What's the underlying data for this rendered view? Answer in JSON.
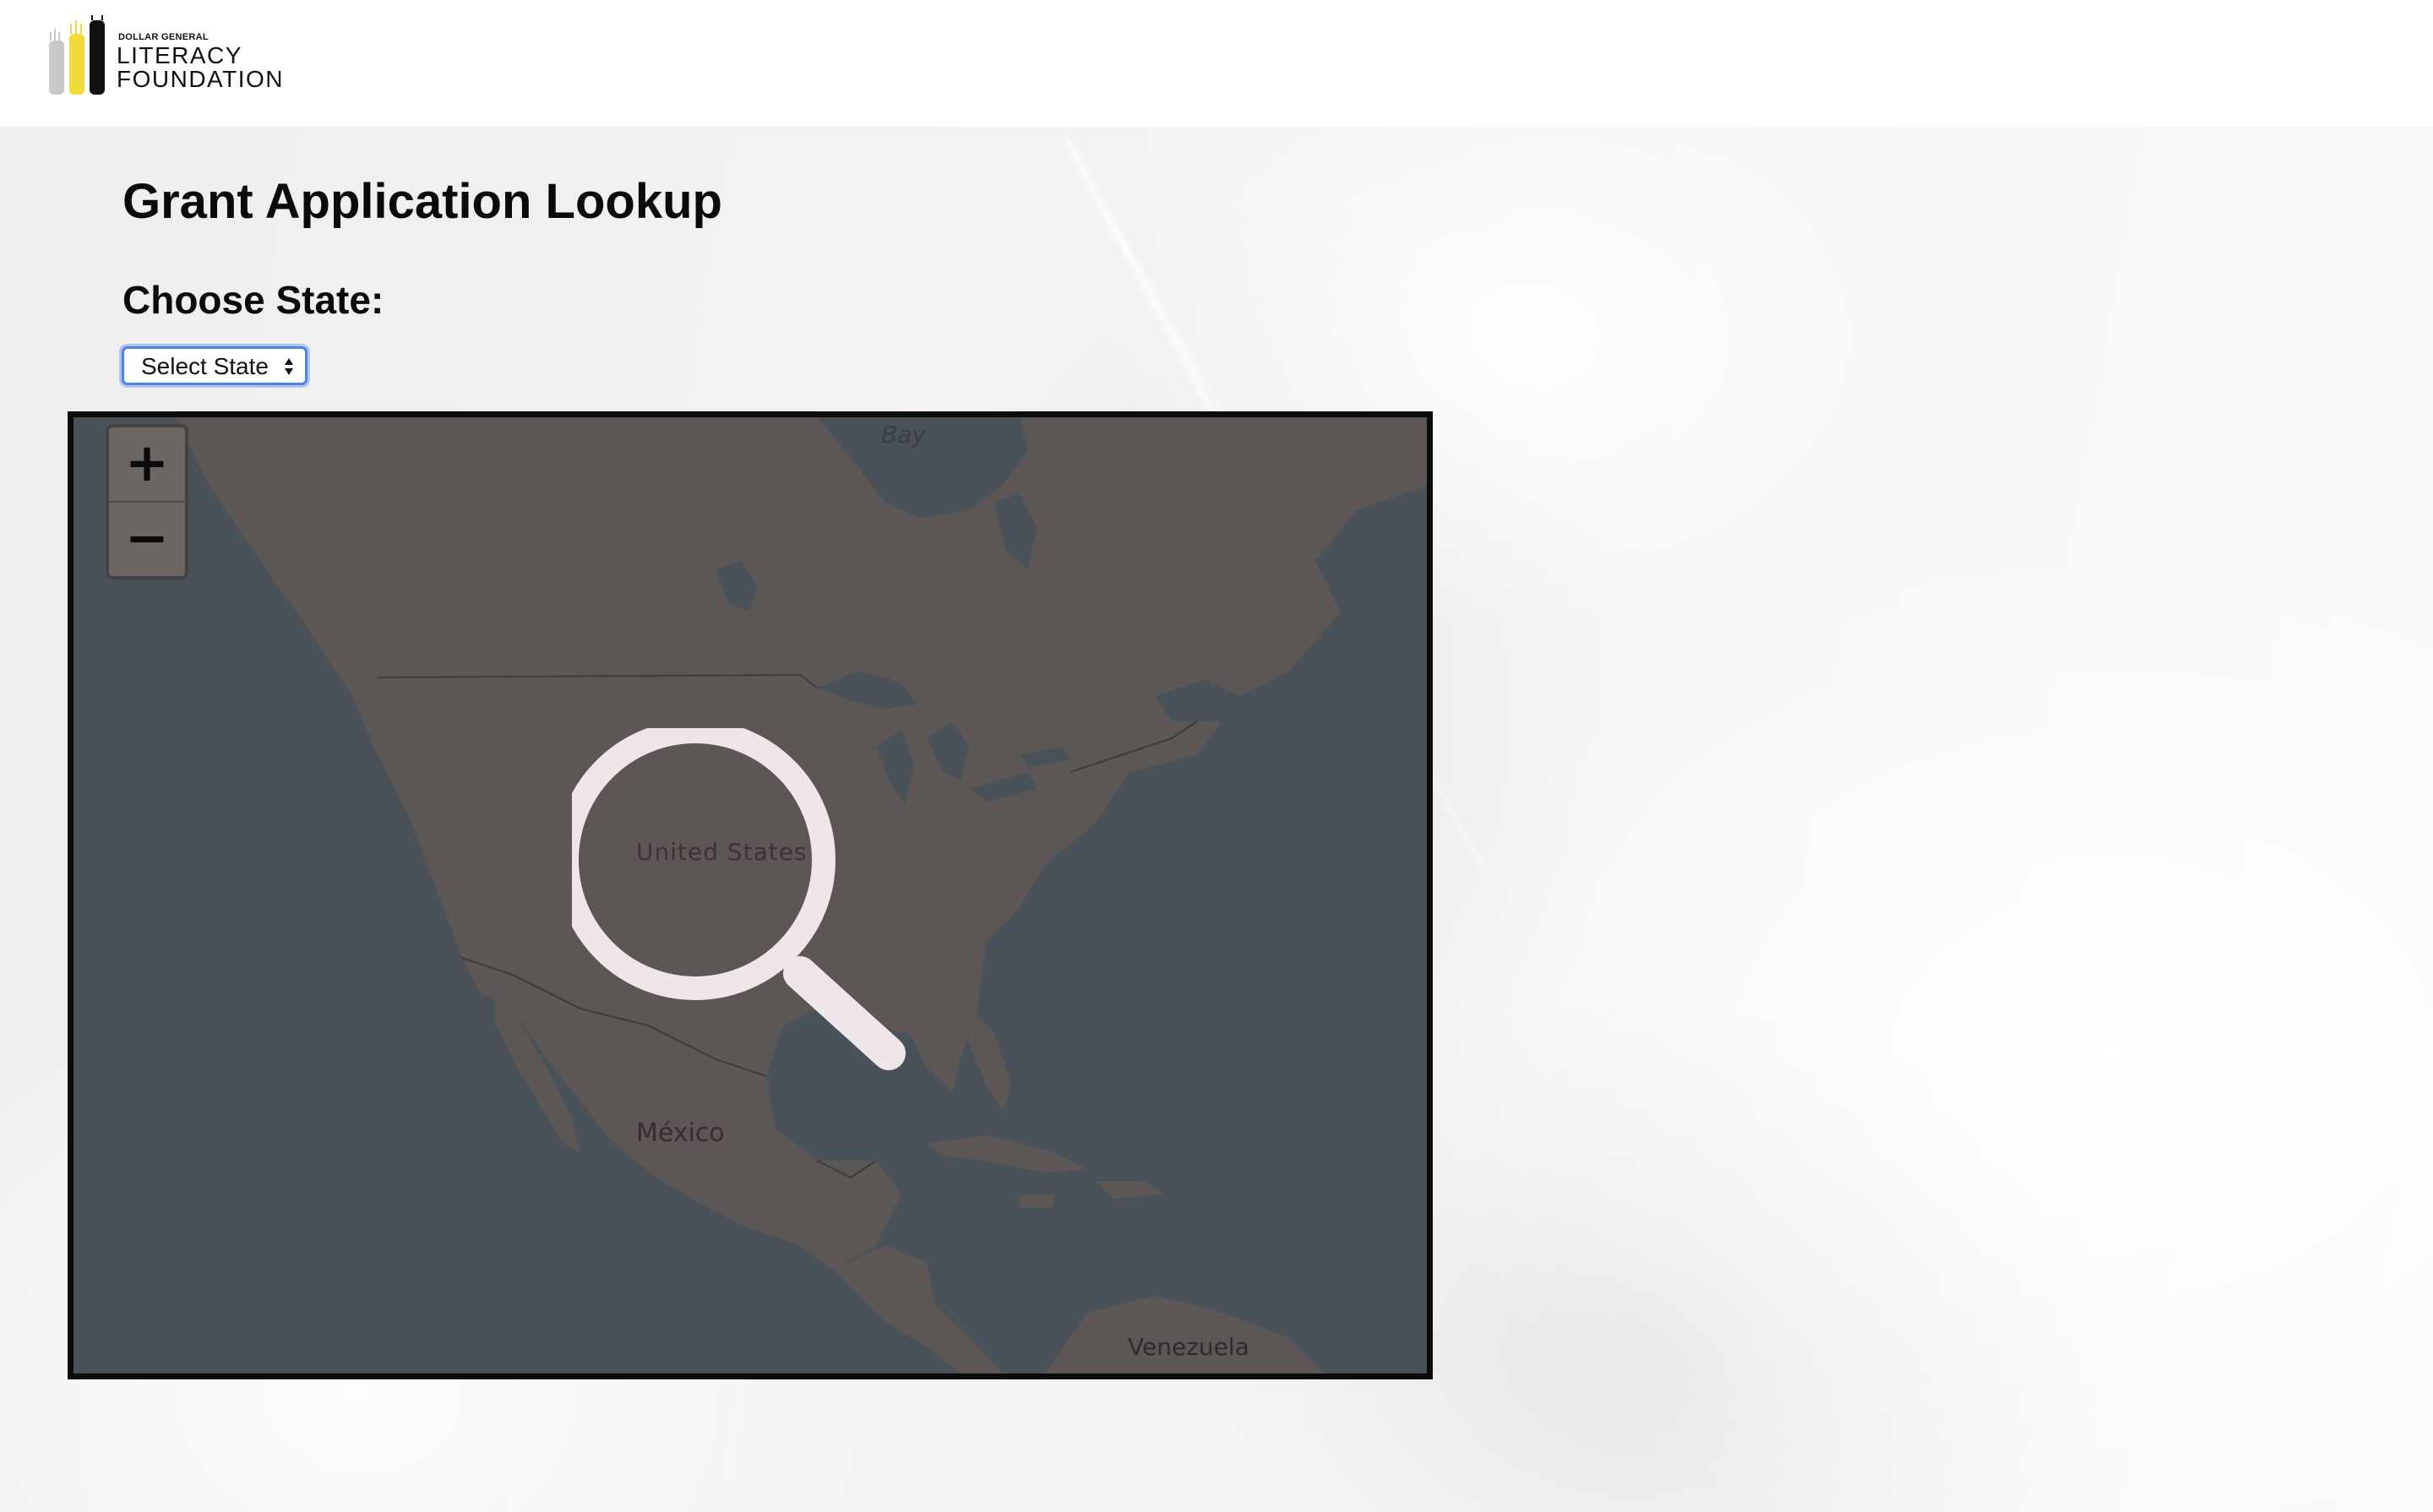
{
  "header": {
    "logo": {
      "small_text": "DOLLAR GENERAL",
      "line1": "LITERACY",
      "line2": "FOUNDATION"
    }
  },
  "main": {
    "title": "Grant Application Lookup",
    "choose_label": "Choose State:",
    "state_select": {
      "selected": "Select State"
    }
  },
  "map": {
    "zoom_in_label": "+",
    "zoom_out_label": "−",
    "labels": {
      "bay": "Bay",
      "united_states": "United States",
      "mexico": "México",
      "venezuela": "Venezuela"
    },
    "overlay_icon": "magnifier-icon",
    "colors": {
      "water": "#4a5259",
      "land": "#5c5654",
      "border": "#0c0c0c"
    }
  },
  "colors": {
    "select_focus": "#4f83e6",
    "logo_yellow": "#f2da3a",
    "logo_gray": "#c9c9c9"
  }
}
